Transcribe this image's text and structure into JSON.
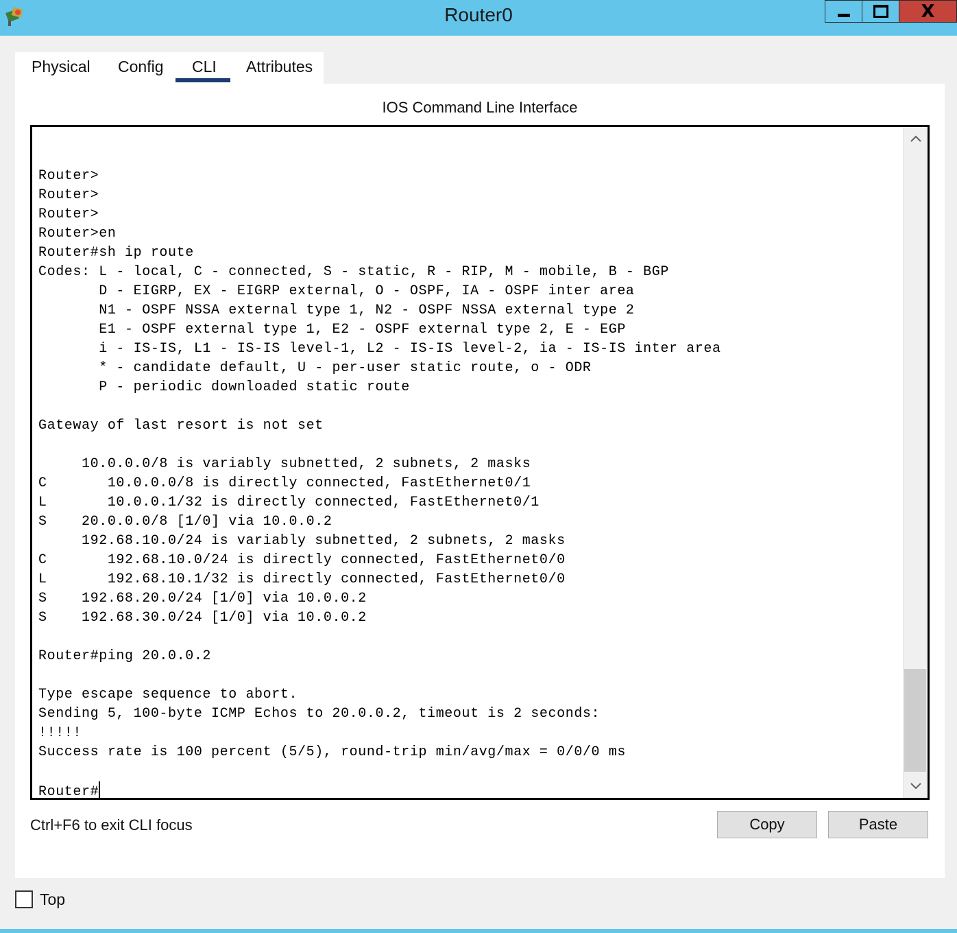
{
  "window": {
    "title": "Router0",
    "close_glyph": "X"
  },
  "tabs": [
    {
      "label": "Physical",
      "active": false
    },
    {
      "label": "Config",
      "active": false
    },
    {
      "label": "CLI",
      "active": true
    },
    {
      "label": "Attributes",
      "active": false
    }
  ],
  "cli": {
    "heading": "IOS Command Line Interface",
    "output": "Router>\nRouter>\nRouter>\nRouter>en\nRouter#sh ip route\nCodes: L - local, C - connected, S - static, R - RIP, M - mobile, B - BGP\n       D - EIGRP, EX - EIGRP external, O - OSPF, IA - OSPF inter area\n       N1 - OSPF NSSA external type 1, N2 - OSPF NSSA external type 2\n       E1 - OSPF external type 1, E2 - OSPF external type 2, E - EGP\n       i - IS-IS, L1 - IS-IS level-1, L2 - IS-IS level-2, ia - IS-IS inter area\n       * - candidate default, U - per-user static route, o - ODR\n       P - periodic downloaded static route\n\nGateway of last resort is not set\n\n     10.0.0.0/8 is variably subnetted, 2 subnets, 2 masks\nC       10.0.0.0/8 is directly connected, FastEthernet0/1\nL       10.0.0.1/32 is directly connected, FastEthernet0/1\nS    20.0.0.0/8 [1/0] via 10.0.0.2\n     192.68.10.0/24 is variably subnetted, 2 subnets, 2 masks\nC       192.68.10.0/24 is directly connected, FastEthernet0/0\nL       192.68.10.1/32 is directly connected, FastEthernet0/0\nS    192.68.20.0/24 [1/0] via 10.0.0.2\nS    192.68.30.0/24 [1/0] via 10.0.0.2\n\nRouter#ping 20.0.0.2\n\nType escape sequence to abort.\nSending 5, 100-byte ICMP Echos to 20.0.0.2, timeout is 2 seconds:\n!!!!!\nSuccess rate is 100 percent (5/5), round-trip min/avg/max = 0/0/0 ms\n\n",
    "prompt": "Router#",
    "focus_hint": "Ctrl+F6 to exit CLI focus",
    "copy_label": "Copy",
    "paste_label": "Paste"
  },
  "footer": {
    "top_label": "Top",
    "top_checked": false
  },
  "colors": {
    "titlebar": "#63c5ea",
    "close_button": "#c4443c",
    "active_tab_underline": "#1a3c6e"
  },
  "icons": [
    "app-icon",
    "minimize-icon",
    "maximize-icon",
    "close-icon",
    "scroll-up-icon",
    "scroll-down-icon"
  ]
}
